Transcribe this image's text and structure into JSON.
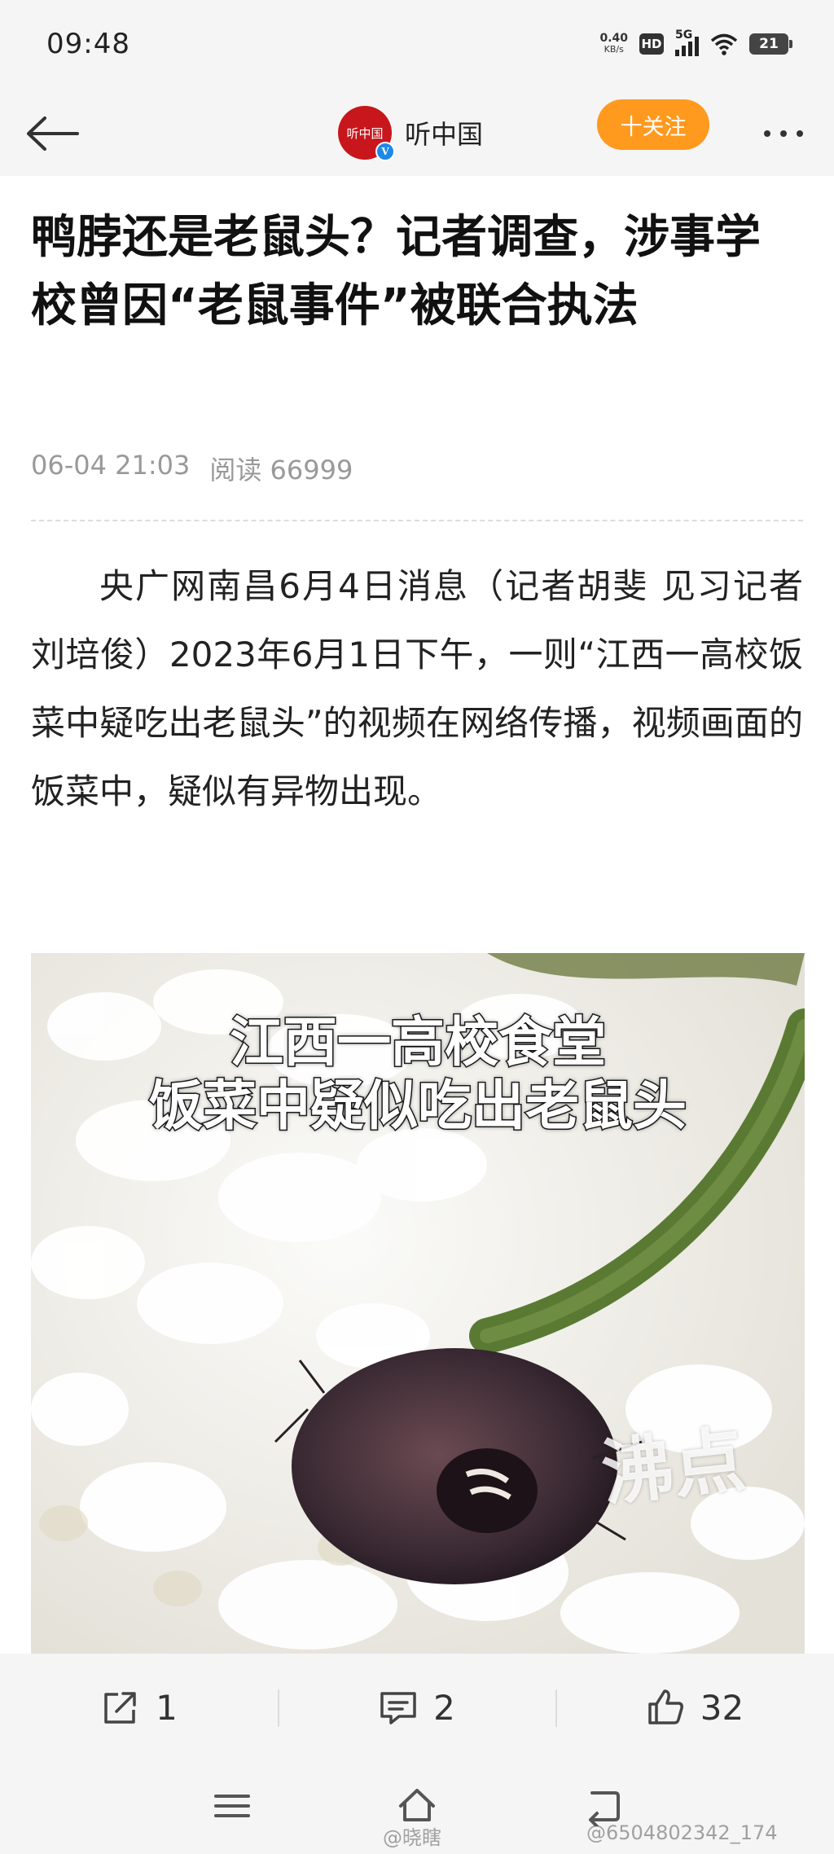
{
  "status_bar": {
    "time": "09:48",
    "net_speed_value": "0.40",
    "net_speed_unit": "KB/s",
    "hd_label": "HD",
    "network_label": "5G",
    "battery_level": "21"
  },
  "header": {
    "back_icon": "arrow-left-icon",
    "channel_logo_text": "听中国",
    "verified_mark": "V",
    "channel_name": "听中国",
    "follow_label": "十关注",
    "more_icon": "more-dots-icon"
  },
  "article": {
    "title": "鸭脖还是老鼠头？记者调查，涉事学校曾因“老鼠事件”被联合执法",
    "date": "06-04 21:03",
    "read_count": "阅读 66999",
    "body": "央广网南昌6月4日消息（记者胡斐 见习记者刘培俊）2023年6月1日下午，一则“江西一高校饭菜中疑吃出老鼠头”的视频在网络传播，视频画面的饭菜中，疑似有异物出现。",
    "image": {
      "caption_line1": "江西一高校食堂",
      "caption_line2": "饭菜中疑似吃出老鼠头",
      "watermark": "沸点"
    }
  },
  "actions": {
    "share_count": "1",
    "comment_count": "2",
    "like_count": "32"
  },
  "footer": {
    "watermark_left": "@晓瞎",
    "watermark_right": "@6504802342_174"
  },
  "colors": {
    "accent": "#ff9a1f",
    "brand_red": "#c8161d",
    "verified_blue": "#1e88e5",
    "bar_bg": "#f5f5f5"
  }
}
